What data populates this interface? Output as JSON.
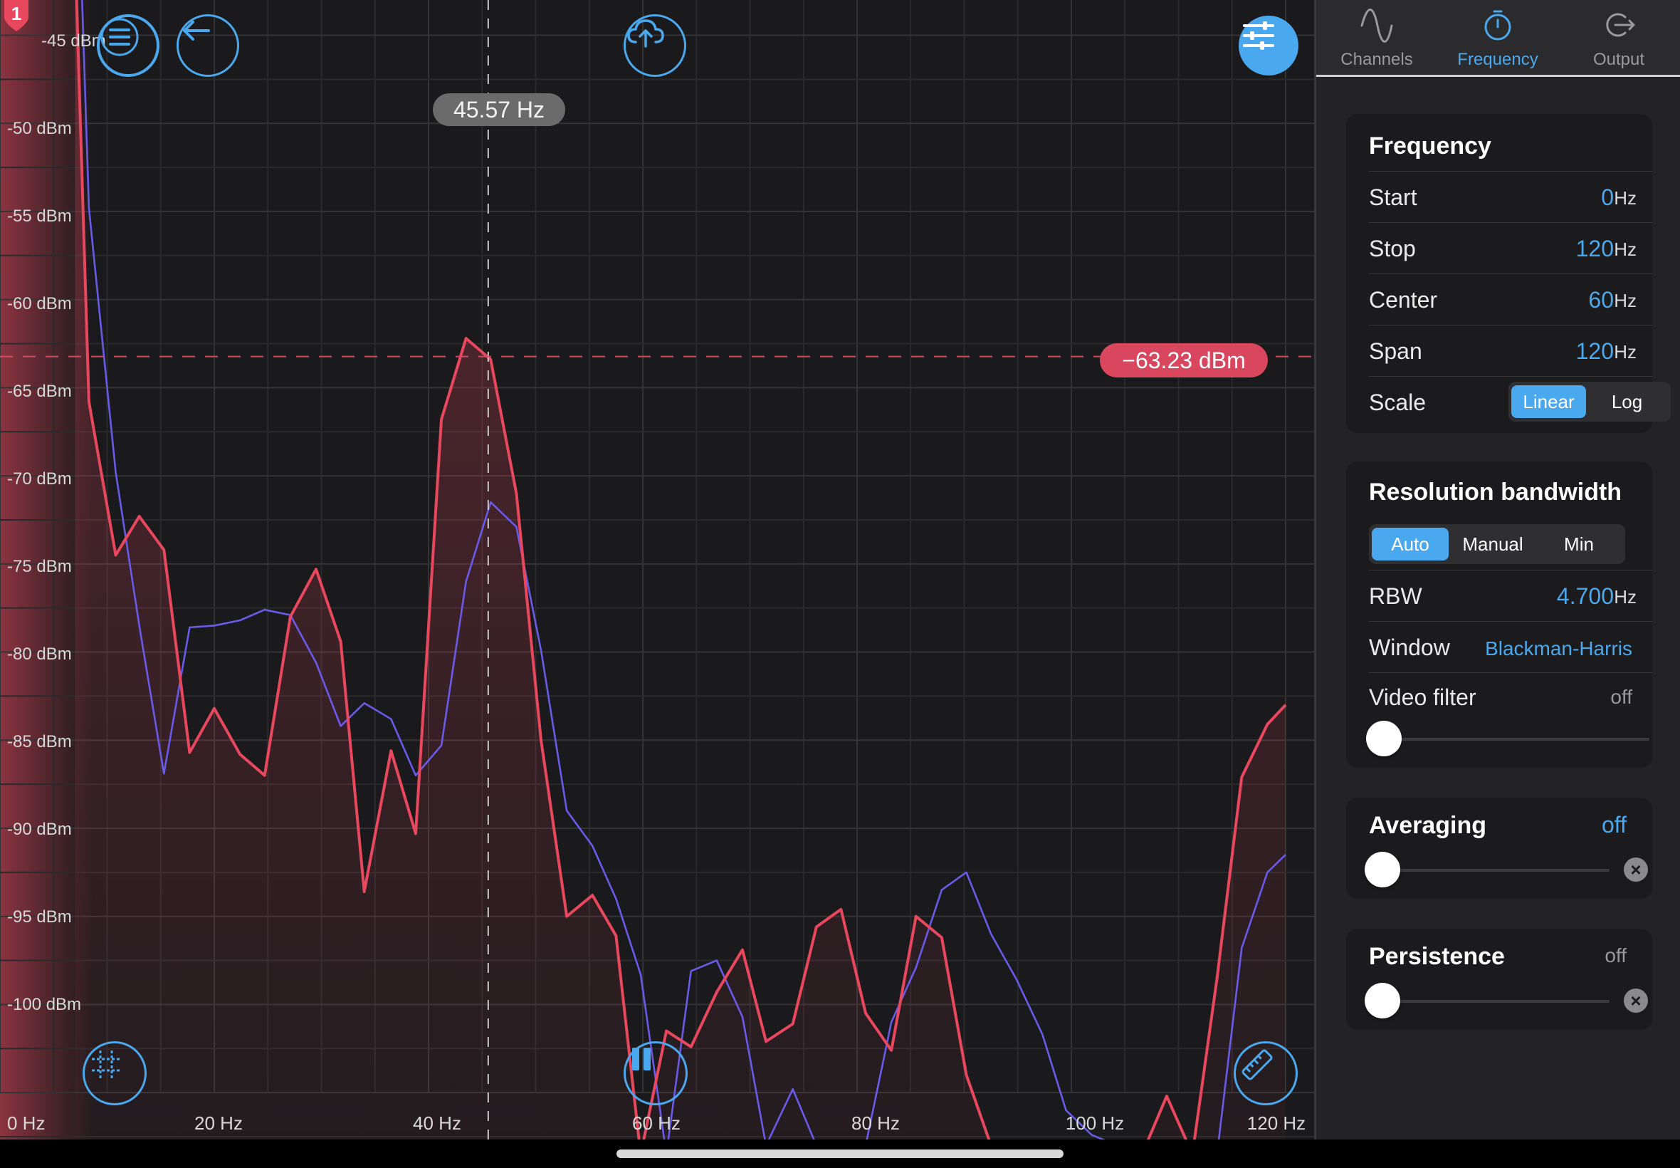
{
  "marker_badge": "1",
  "cursor": {
    "freq_label": "45.57 Hz",
    "level_label": "−63.23 dBm",
    "freq_hz": 45.57,
    "level_dbm": -63.23
  },
  "chart_data": {
    "type": "line",
    "xlabel": "",
    "ylabel": "",
    "xlim": [
      0,
      120
    ],
    "ylim": [
      -107.5,
      -43
    ],
    "x_ticks": [
      0,
      20,
      40,
      60,
      80,
      100,
      120
    ],
    "x_tick_labels": [
      "0 Hz",
      "20 Hz",
      "40 Hz",
      "60 Hz",
      "80 Hz",
      "100 Hz",
      "120 Hz"
    ],
    "y_ticks": [
      -45,
      -50,
      -55,
      -60,
      -65,
      -70,
      -75,
      -80,
      -85,
      -90,
      -95,
      -100
    ],
    "y_tick_labels": [
      "-45 dBm",
      "-50 dBm",
      "-55 dBm",
      "-60 dBm",
      "-65 dBm",
      "-70 dBm",
      "-75 dBm",
      "-80 dBm",
      "-85 dBm",
      "-90 dBm",
      "-95 dBm",
      "-100 dBm"
    ],
    "grid": true,
    "series": [
      {
        "color": "#e8485e",
        "fill": true,
        "x": [
          7,
          8.3,
          10.8,
          13,
          15.3,
          17.7,
          20,
          22.4,
          24.7,
          27.1,
          29.5,
          31.8,
          34,
          36.5,
          38.8,
          41.2,
          43.5,
          45.8,
          48.2,
          50.5,
          52.9,
          55.3,
          57.5,
          59.8,
          62.2,
          64.5,
          66.9,
          69.3,
          71.5,
          74,
          76.2,
          78.5,
          80.8,
          83.2,
          85.5,
          87.9,
          90.2,
          92.5,
          94.9,
          97.3,
          99.5,
          101.9,
          104.3,
          106.6,
          108.9,
          111.3,
          113.6,
          115.9,
          118.3,
          120
        ],
        "y": [
          -40,
          -65.8,
          -74.5,
          -72.3,
          -74.2,
          -85.7,
          -83.2,
          -85.8,
          -87,
          -78,
          -75.3,
          -79.4,
          -93.6,
          -85.6,
          -90.3,
          -66.8,
          -62.2,
          -63.4,
          -71,
          -85,
          -95,
          -93.8,
          -96.1,
          -108.5,
          -101.5,
          -102.4,
          -99.3,
          -96.9,
          -102.1,
          -101.1,
          -95.6,
          -94.6,
          -100.5,
          -102.6,
          -95,
          -96.2,
          -104,
          -108,
          -108.5,
          -108,
          -108,
          -108,
          -108,
          -108.5,
          -105.2,
          -108.5,
          -98.5,
          -87.1,
          -84.1,
          -83
        ]
      },
      {
        "color": "#6a5ae8",
        "fill": false,
        "x": [
          7.5,
          8.3,
          10.8,
          13,
          15.3,
          17.7,
          20,
          22.4,
          24.7,
          27.1,
          29.5,
          31.8,
          34,
          36.5,
          38.8,
          41.2,
          43.5,
          45.8,
          48.2,
          50.5,
          52.9,
          55.3,
          57.5,
          59.8,
          62.2,
          64.5,
          66.9,
          69.3,
          71.5,
          74,
          76.2,
          78.5,
          80.8,
          83.2,
          85.5,
          87.9,
          90.2,
          92.5,
          94.9,
          97.3,
          99.5,
          101.9,
          104.3,
          106.6,
          108.9,
          111.3,
          113.6,
          115.9,
          118.3,
          120
        ],
        "y": [
          -40,
          -54.8,
          -69.8,
          -78.5,
          -86.9,
          -78.6,
          -78.5,
          -78.2,
          -77.6,
          -77.9,
          -80.6,
          -84.2,
          -82.9,
          -83.8,
          -87,
          -85.3,
          -76,
          -71.5,
          -72.9,
          -79.9,
          -89,
          -91,
          -94,
          -98.3,
          -108.5,
          -98.1,
          -97.5,
          -100.7,
          -108,
          -104.8,
          -108,
          -108,
          -108,
          -101,
          -97.9,
          -93.5,
          -92.5,
          -96,
          -98.6,
          -101.7,
          -106,
          -107.4,
          -108,
          -108,
          -108,
          -108,
          -108.5,
          -96.8,
          -92.5,
          -91.5
        ]
      }
    ]
  },
  "toolbar": {
    "menu_icon": "menu-icon",
    "back_icon": "back-arrow-icon",
    "upload_icon": "cloud-upload-icon",
    "settings_icon": "sliders-icon",
    "grid_icon": "grid-icon",
    "pause_icon": "pause-icon",
    "measure_icon": "ruler-icon"
  },
  "tabs": [
    {
      "label": "Channels",
      "icon": "sine-wave-icon",
      "active": false
    },
    {
      "label": "Frequency",
      "icon": "stopwatch-icon",
      "active": true
    },
    {
      "label": "Output",
      "icon": "output-arrow-icon",
      "active": false
    }
  ],
  "frequency": {
    "title": "Frequency",
    "rows": [
      {
        "label": "Start",
        "value": "0",
        "unit": "Hz"
      },
      {
        "label": "Stop",
        "value": "120",
        "unit": "Hz"
      },
      {
        "label": "Center",
        "value": "60",
        "unit": "Hz"
      },
      {
        "label": "Span",
        "value": "120",
        "unit": "Hz"
      }
    ],
    "scale_label": "Scale",
    "scale_options": [
      "Linear",
      "Log"
    ],
    "scale_selected": "Linear"
  },
  "rbw": {
    "title": "Resolution bandwidth",
    "mode_options": [
      "Auto",
      "Manual",
      "Min"
    ],
    "mode_selected": "Auto",
    "rbw_label": "RBW",
    "rbw_value": "4.700",
    "rbw_unit": "Hz",
    "window_label": "Window",
    "window_value": "Blackman-Harris",
    "video_filter_label": "Video filter",
    "video_filter_value": "off",
    "video_filter_level": 0
  },
  "averaging": {
    "title": "Averaging",
    "value": "off",
    "level": 0
  },
  "persistence": {
    "title": "Persistence",
    "value": "off",
    "level": 0
  },
  "colors": {
    "accent": "#4aa8ee",
    "trace_red": "#e8485e",
    "trace_blue": "#6a5ae8",
    "panel_bg": "#232325",
    "card_bg": "#1b1b1d"
  }
}
